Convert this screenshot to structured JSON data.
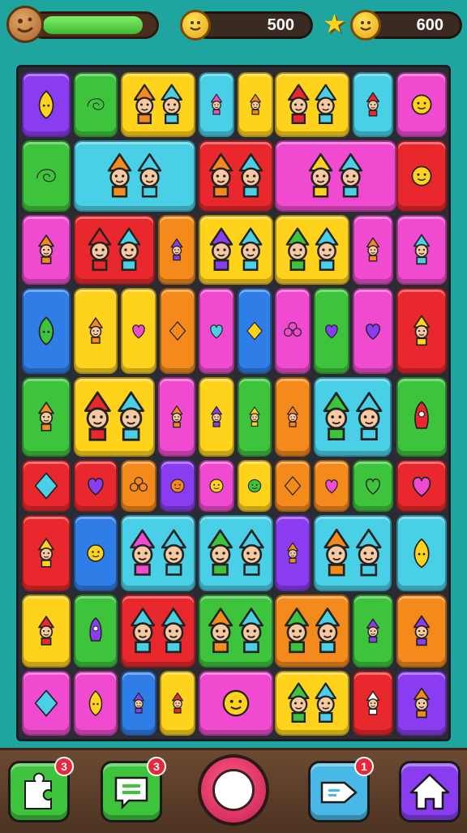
{
  "hud": {
    "health_level": 0.88,
    "coin_value": "500",
    "gem_value": "600",
    "health_color": "#3fb92e",
    "coin_color": "#ffd21f"
  },
  "board": {
    "tile_palette": {
      "purple": "#8a3cf0",
      "green": "#3ec43c",
      "yellow": "#ffd21c",
      "cyan": "#49cfe6",
      "pink": "#f04bd0",
      "red": "#e8282c",
      "orange": "#f58a1c",
      "blue": "#2f7de6"
    },
    "tiles": [
      {
        "name": "tile-leaf-purple",
        "icon": "leaf"
      },
      {
        "name": "tile-swirl-green",
        "icon": "swirl"
      },
      {
        "name": "tile-gnomes-yellow",
        "icon": "gnome-pair"
      },
      {
        "name": "tile-gnome-cyan",
        "icon": "gnome"
      },
      {
        "name": "tile-gnome-yellow",
        "icon": "gnome"
      },
      {
        "name": "tile-gnomes-yellow-2",
        "icon": "gnome-pair"
      },
      {
        "name": "tile-gnome-cyan-2",
        "icon": "gnome"
      },
      {
        "name": "tile-face-pink",
        "icon": "face"
      }
    ]
  },
  "bottom_bar": {
    "puzzle_badge": "3",
    "chat_badge": "3",
    "ticket_badge": "1"
  }
}
